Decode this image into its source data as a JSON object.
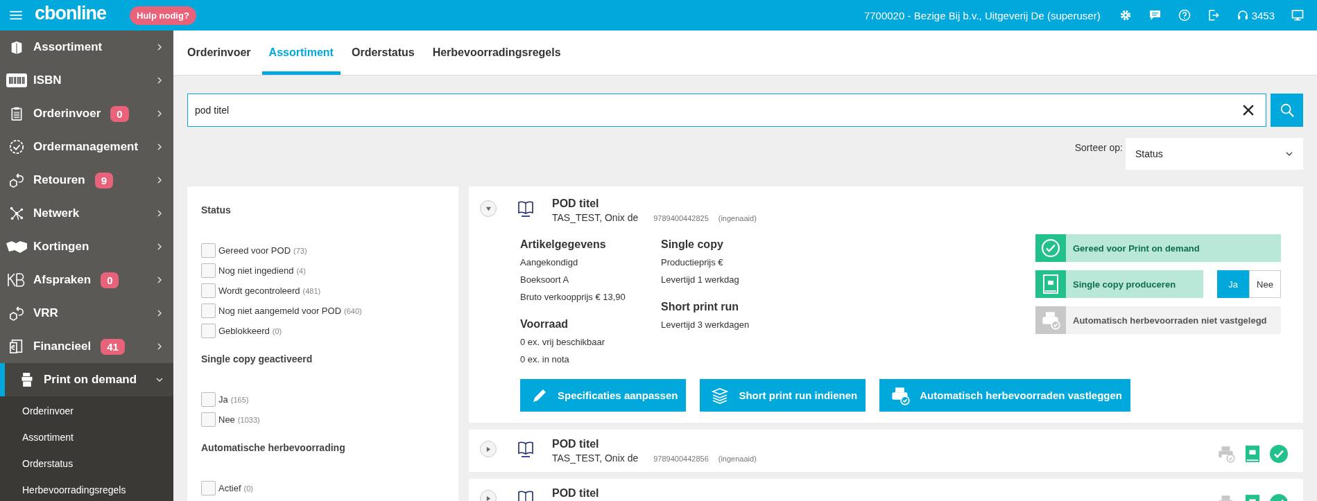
{
  "topbar": {
    "logo": "cbonline",
    "help": "Hulp nodig?",
    "account": "7700020 - Bezige Bij b.v., Uitgeverij De (superuser)",
    "headset_count": "3453"
  },
  "sidebar": {
    "items": [
      {
        "label": "Assortiment",
        "expanded": false
      },
      {
        "label": "ISBN",
        "expanded": false
      },
      {
        "label": "Orderinvoer",
        "badge": "0",
        "expanded": false
      },
      {
        "label": "Ordermanagement",
        "expanded": false
      },
      {
        "label": "Retouren",
        "badge": "9",
        "expanded": false
      },
      {
        "label": "Netwerk",
        "expanded": false
      },
      {
        "label": "Kortingen",
        "expanded": false
      },
      {
        "label": "Afspraken",
        "badge": "0",
        "expanded": false
      },
      {
        "label": "VRR",
        "expanded": false
      },
      {
        "label": "Financieel",
        "badge": "41",
        "expanded": false
      },
      {
        "label": "Print on demand",
        "expanded": true,
        "children": [
          "Orderinvoer",
          "Assortiment",
          "Orderstatus",
          "Herbevoorradingsregels"
        ]
      }
    ]
  },
  "tabs": [
    {
      "label": "Orderinvoer",
      "selected": false
    },
    {
      "label": "Assortiment",
      "selected": true
    },
    {
      "label": "Orderstatus",
      "selected": false
    },
    {
      "label": "Herbevoorradingsregels",
      "selected": false
    }
  ],
  "search": {
    "value": "pod titel"
  },
  "sort": {
    "label": "Sorteer op:",
    "value": "Status"
  },
  "filters": [
    {
      "title": "Status",
      "options": [
        {
          "label": "Gereed voor POD",
          "count": "(73)",
          "checked": false
        },
        {
          "label": "Nog niet ingediend",
          "count": "(4)",
          "checked": false
        },
        {
          "label": "Wordt gecontroleerd",
          "count": "(481)",
          "checked": false
        },
        {
          "label": "Nog niet aangemeld voor POD",
          "count": "(640)",
          "checked": false
        },
        {
          "label": "Geblokkeerd",
          "count": "(0)",
          "checked": false
        }
      ]
    },
    {
      "title": "Single copy geactiveerd",
      "options": [
        {
          "label": "Ja",
          "count": "(165)",
          "checked": false
        },
        {
          "label": "Nee",
          "count": "(1033)",
          "checked": false
        }
      ]
    },
    {
      "title": "Automatische herbevoorrading",
      "options": [
        {
          "label": "Actief",
          "count": "(0)",
          "checked": false
        }
      ]
    }
  ],
  "results": [
    {
      "title": "POD titel",
      "author": "TAS_TEST, Onix de",
      "isbn": "9789400442825",
      "binding": "(ingenaaid)",
      "expanded": true,
      "ready": true,
      "single_copy": true,
      "auto_restock": false,
      "details": {
        "columns": [
          {
            "sections": [
              {
                "heading": "Artikelgegevens",
                "lines": [
                  "Aangekondigd",
                  "Boeksoort A",
                  "Bruto verkoopprijs € 13,90"
                ]
              },
              {
                "heading": "Voorraad",
                "lines": [
                  "0 ex. vrij beschikbaar",
                  "0 ex. in nota"
                ]
              }
            ]
          },
          {
            "sections": [
              {
                "heading": "Single copy",
                "lines": [
                  "Productieprijs €",
                  "Levertijd 1 werkdag"
                ]
              },
              {
                "heading": "Short print run",
                "lines": [
                  "Levertijd 3 werkdagen"
                ]
              }
            ]
          }
        ],
        "status_lines": [
          {
            "kind": "ready",
            "label": "Gereed voor Print on demand"
          },
          {
            "kind": "single",
            "label": "Single copy produceren",
            "toggle": [
              {
                "label": "Ja",
                "selected": true
              },
              {
                "label": "Nee",
                "selected": false
              }
            ]
          },
          {
            "kind": "auto",
            "label": "Automatisch herbevoorraden niet vastgelegd"
          }
        ],
        "actions": [
          {
            "kind": "pencil",
            "label": "Specificaties aanpassen"
          },
          {
            "kind": "stack",
            "label": "Short print run indienen"
          },
          {
            "kind": "printer",
            "label": "Automatisch herbevoorraden vastleggen"
          }
        ]
      }
    },
    {
      "title": "POD titel",
      "author": "TAS_TEST, Onix de",
      "isbn": "9789400442856",
      "binding": "(ingenaaid)",
      "expanded": false,
      "ready": true,
      "single_copy": true,
      "auto_restock": false
    },
    {
      "title": "POD titel",
      "expanded": false,
      "ready": true,
      "single_copy": true,
      "auto_restock": false
    }
  ]
}
